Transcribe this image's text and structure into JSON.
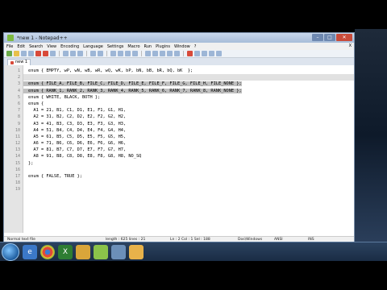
{
  "window": {
    "title": "*new 1 - Notepad++",
    "controls": {
      "minimize": "–",
      "maximize": "□",
      "close": "✕"
    }
  },
  "menu": {
    "items": [
      "File",
      "Edit",
      "Search",
      "View",
      "Encoding",
      "Language",
      "Settings",
      "Macro",
      "Run",
      "Plugins",
      "Window",
      "?"
    ],
    "close": "X"
  },
  "tab": {
    "label": "new 1"
  },
  "editor": {
    "lines": [
      {
        "num": "1",
        "text": "enum { EMPTY, wP, wN, wB, wR, wQ, wK, bP, bN, bB, bR, bQ, bK  };"
      },
      {
        "num": "2",
        "text": ""
      },
      {
        "num": "3",
        "text": "enum { FILE_A, FILE_B, FILE_C, FILE_D, FILE_E, FILE_F, FILE_G, FILE_H, FILE_NONE };"
      },
      {
        "num": "4",
        "text": "enum { RANK_1, RANK_2, RANK_3, RANK_4, RANK_5, RANK_6, RANK_7, RANK_8, RANK_NONE };"
      },
      {
        "num": "5",
        "text": "enum { WHITE, BLACK, BOTH };"
      },
      {
        "num": "6",
        "text": "enum {"
      },
      {
        "num": "7",
        "text": "  A1 = 21, B1, C1, D1, E1, F1, G1, H1,"
      },
      {
        "num": "8",
        "text": "  A2 = 31, B2, C2, D2, E2, F2, G2, H2,"
      },
      {
        "num": "9",
        "text": "  A3 = 41, B3, C3, D3, E3, F3, G3, H3,"
      },
      {
        "num": "10",
        "text": "  A4 = 51, B4, C4, D4, E4, F4, G4, H4,"
      },
      {
        "num": "11",
        "text": "  A5 = 61, B5, C5, D5, E5, F5, G5, H5,"
      },
      {
        "num": "12",
        "text": "  A6 = 71, B6, C6, D6, E6, F6, G6, H6,"
      },
      {
        "num": "13",
        "text": "  A7 = 81, B7, C7, D7, E7, F7, G7, H7,"
      },
      {
        "num": "14",
        "text": "  A8 = 91, B8, C8, D8, E8, F8, G8, H8, NO_SQ"
      },
      {
        "num": "15",
        "text": "};"
      },
      {
        "num": "16",
        "text": ""
      },
      {
        "num": "17",
        "text": "enum { FALSE, TRUE };"
      },
      {
        "num": "18",
        "text": ""
      },
      {
        "num": "19",
        "text": ""
      }
    ]
  },
  "status": {
    "type": "Normal text file",
    "length": "length : 625    lines : 21",
    "position": "Ln : 2    Col : 1    Sel : 188",
    "eol": "Dos\\Windows",
    "encoding": "ANSI",
    "mode": "INS"
  },
  "taskbar": {
    "clock_time": "",
    "apps": [
      "start-orb",
      "ie",
      "chrome",
      "excel",
      "folder",
      "notepadpp",
      "explorer",
      "paint"
    ]
  },
  "colors": {
    "selection": "#c0c0c0",
    "current_line": "#e1e1e1",
    "taskbar": "#1f3350",
    "titlebar": "#b8cbe4"
  }
}
